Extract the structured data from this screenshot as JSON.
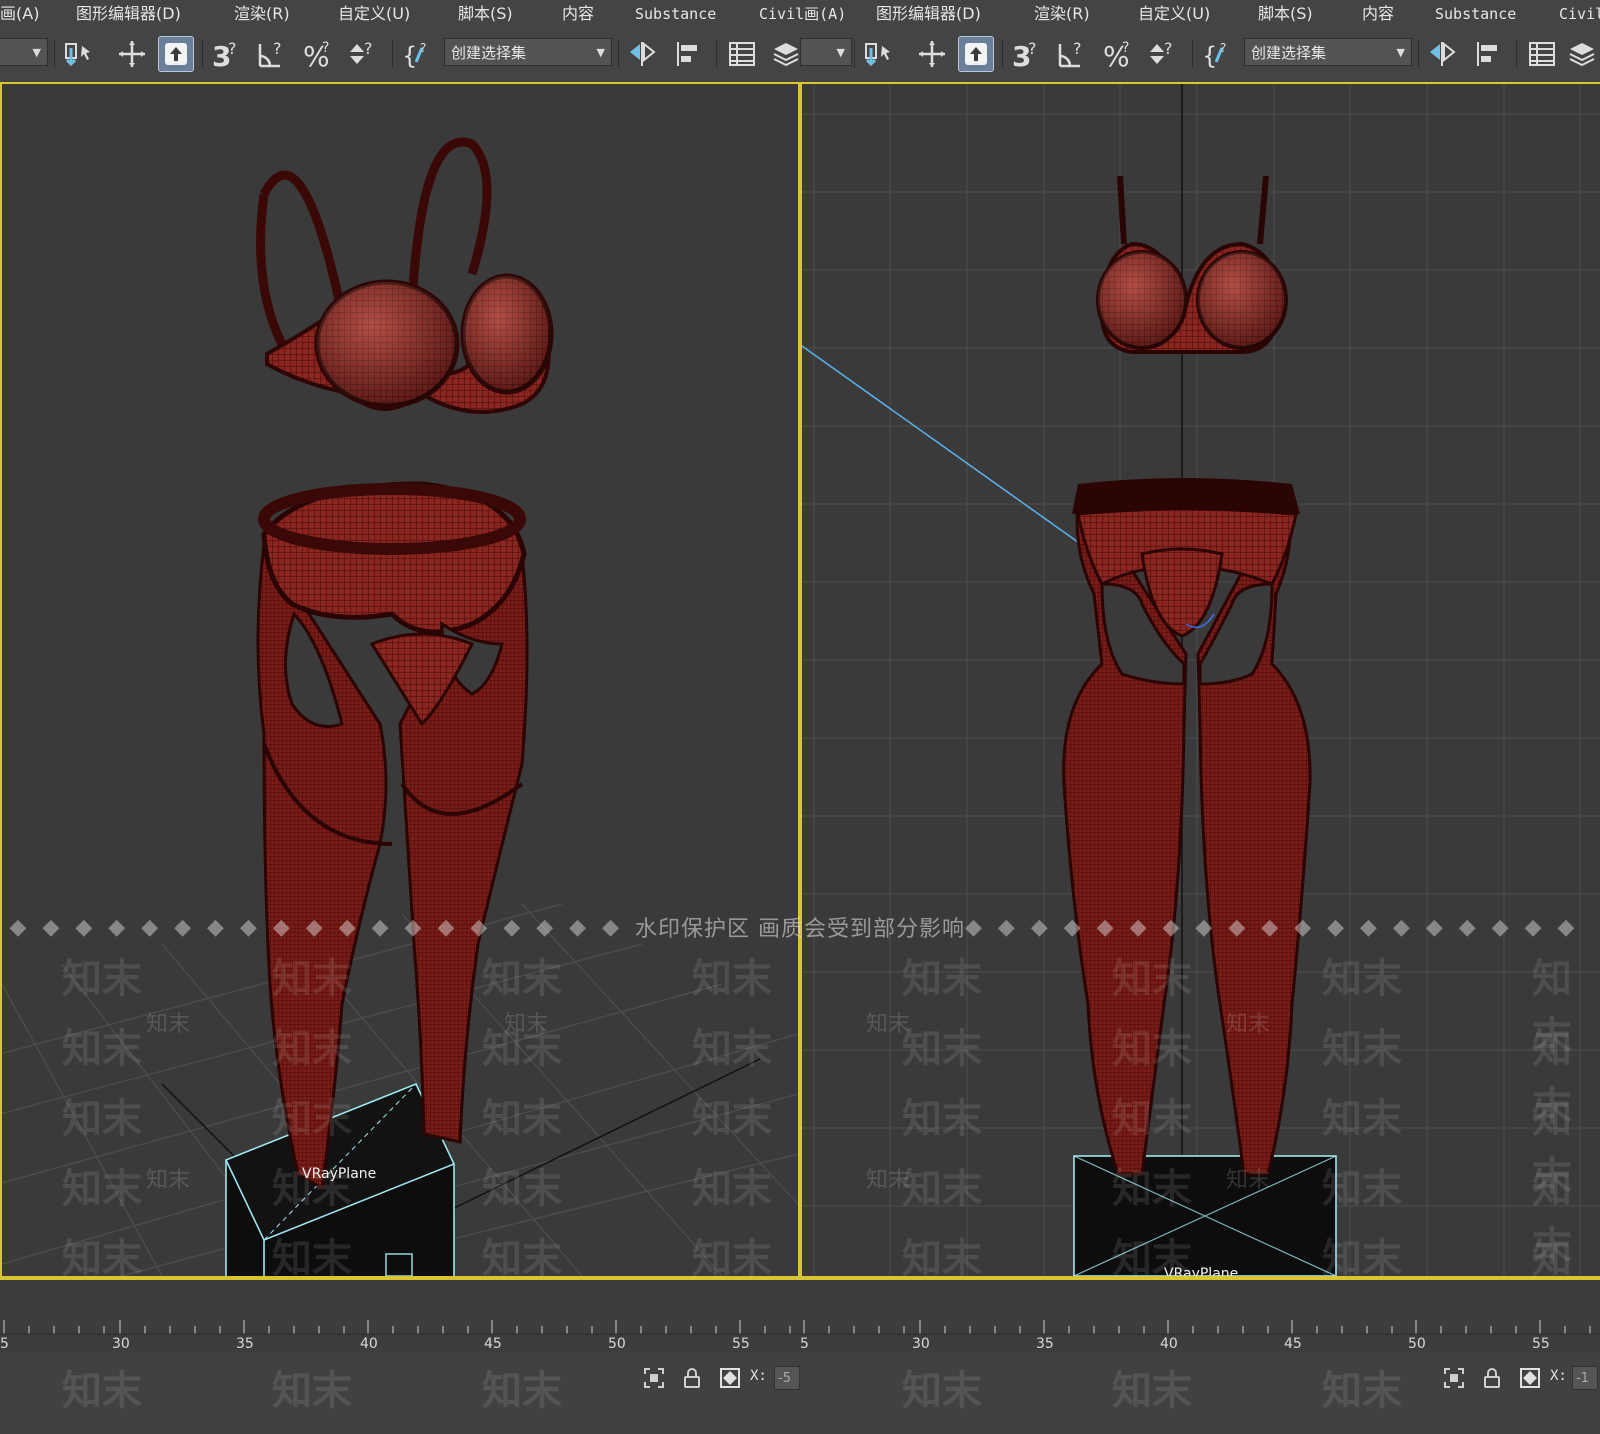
{
  "menubar": {
    "items": [
      "画(A)",
      "图形编辑器(D)",
      "渲染(R)",
      "自定义(U)",
      "脚本(S)",
      "内容",
      "Substance",
      "Civil",
      "图形编辑器(D)",
      "渲染(R)",
      "自定义(U)",
      "脚本(S)",
      "内容",
      "Substance",
      "Civil"
    ],
    "civil_suffix": "画(A)"
  },
  "toolbar": {
    "selection_set_placeholder": "创建选择集",
    "icons": [
      "select-link-icon",
      "move-icon",
      "select-object-icon",
      "snap-3d-icon",
      "angle-snap-icon",
      "percent-snap-icon",
      "spinner-snap-icon",
      "named-selection-icon",
      "mirror-icon",
      "align-icon",
      "scene-explorer-icon",
      "layer-icon"
    ]
  },
  "viewports": {
    "left": {
      "object_label": "VRayPlane"
    },
    "right": {
      "object_label": "VRayPlane"
    }
  },
  "watermark": {
    "notice": "水印保护区   画质会受到部分影响",
    "brand": "知末"
  },
  "timeline": {
    "tick_labels_left": [
      "5",
      "30",
      "35",
      "40",
      "45",
      "50",
      "55"
    ],
    "tick_labels_right": [
      "5",
      "30",
      "35",
      "40",
      "45",
      "50",
      "55"
    ]
  },
  "status": {
    "x_label": "X:",
    "x_value_left": "-5",
    "x_value_right": "-1"
  },
  "colors": {
    "accent_viewport_border": "#d9c431",
    "model_red": "#7a1a16",
    "vray_outline": "#9fe6ef"
  }
}
